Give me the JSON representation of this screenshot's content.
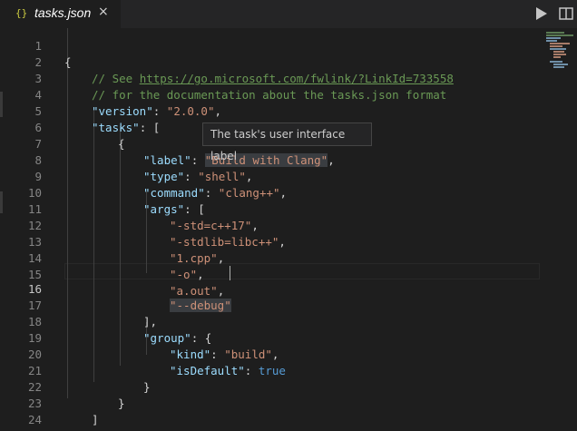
{
  "tab": {
    "icon": "{}",
    "title": "tasks.json",
    "close": "×"
  },
  "toolbar": {
    "run_icon": "run-icon",
    "split_icon": "split-editor-icon"
  },
  "tooltip": {
    "text": "The task's user interface label"
  },
  "lines": [
    {
      "n": "1",
      "t": "{"
    },
    {
      "n": "2",
      "t": "// See https://go.microsoft.com/fwlink/?LinkId=733558"
    },
    {
      "n": "3",
      "t": "// for the documentation about the tasks.json format"
    },
    {
      "n": "4",
      "t": "\"version\": \"2.0.0\","
    },
    {
      "n": "5",
      "t": "\"tasks\": ["
    },
    {
      "n": "6",
      "t": "{"
    },
    {
      "n": "7",
      "t": "\"label\": \"Build with Clang\","
    },
    {
      "n": "8",
      "t": "\"type\": \"shell\","
    },
    {
      "n": "9",
      "t": "\"command\": \"clang++\","
    },
    {
      "n": "10",
      "t": "\"args\": ["
    },
    {
      "n": "11",
      "t": "\"-std=c++17\","
    },
    {
      "n": "12",
      "t": "\"-stdlib=libc++\","
    },
    {
      "n": "13",
      "t": "\"1.cpp\","
    },
    {
      "n": "14",
      "t": "\"-o\","
    },
    {
      "n": "15",
      "t": "\"a.out\","
    },
    {
      "n": "16",
      "t": "\"--debug\""
    },
    {
      "n": "17",
      "t": "],"
    },
    {
      "n": "18",
      "t": "\"group\": {"
    },
    {
      "n": "19",
      "t": "\"kind\": \"build\","
    },
    {
      "n": "20",
      "t": "\"isDefault\": true"
    },
    {
      "n": "21",
      "t": "}"
    },
    {
      "n": "22",
      "t": "}"
    },
    {
      "n": "23",
      "t": "]"
    },
    {
      "n": "24",
      "t": "}"
    }
  ],
  "code": {
    "l2_comment": "// See ",
    "l2_url": "https://go.microsoft.com/fwlink/?LinkId=733558",
    "l3_comment": "// for the documentation about the tasks.json format",
    "version_key": "\"version\"",
    "version_val": "\"2.0.0\"",
    "tasks_key": "\"tasks\"",
    "label_key": "\"label\"",
    "label_val": "\"Build with Clang\"",
    "type_key": "\"type\"",
    "type_val": "\"shell\"",
    "command_key": "\"command\"",
    "command_val": "\"clang++\"",
    "args_key": "\"args\"",
    "arg1": "\"-std=c++17\"",
    "arg2": "\"-stdlib=libc++\"",
    "arg3": "\"1.cpp\"",
    "arg4": "\"-o\"",
    "arg5": "\"a.out\"",
    "arg6": "\"--debug\"",
    "group_key": "\"group\"",
    "kind_key": "\"kind\"",
    "kind_val": "\"build\"",
    "isdefault_key": "\"isDefault\"",
    "isdefault_val": "true"
  },
  "editor": {
    "active_line": "16"
  },
  "colors": {
    "background": "#1e1e1e",
    "key": "#9cdcfe",
    "string": "#ce9178",
    "comment": "#6a9955",
    "boolean": "#569cd6"
  }
}
